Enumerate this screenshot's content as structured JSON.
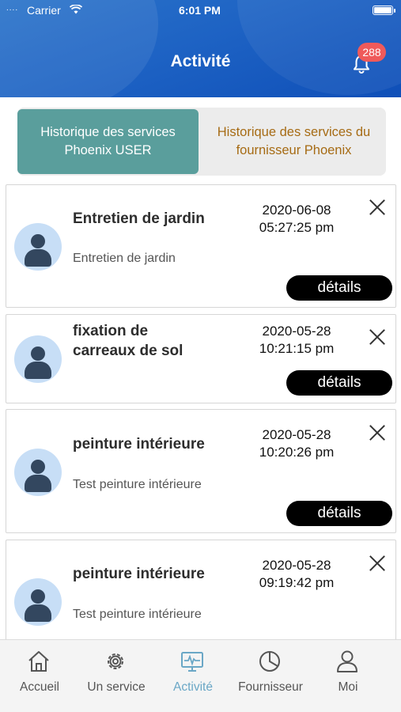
{
  "status_bar": {
    "dots": "....",
    "carrier": "Carrier",
    "time": "6:01 PM",
    "wifi_icon": "wifi-icon",
    "battery_icon": "battery-icon"
  },
  "header": {
    "title": "Activité",
    "notification_count": "288",
    "bell_icon": "bell-icon"
  },
  "tabs": [
    {
      "label_line1": "Historique des services",
      "label_line2": "Phoenix USER",
      "active": true
    },
    {
      "label_line1": "Historique des services du",
      "label_line2": "fournisseur Phoenix",
      "active": false
    }
  ],
  "activities": [
    {
      "title_line1": "Entretien de jardin",
      "title_line2": "",
      "description": "Entretien de jardin",
      "date": "2020-06-08",
      "time": "05:27:25 pm",
      "details_label": "détails"
    },
    {
      "title_line1": "fixation de",
      "title_line2": "carreaux de sol",
      "description": "",
      "date": "2020-05-28",
      "time": "10:21:15 pm",
      "details_label": "détails"
    },
    {
      "title_line1": "peinture intérieure",
      "title_line2": "",
      "description": "Test peinture intérieure",
      "date": "2020-05-28",
      "time": "10:20:26 pm",
      "details_label": "détails"
    },
    {
      "title_line1": "peinture intérieure",
      "title_line2": "",
      "description": "Test peinture intérieure",
      "date": "2020-05-28",
      "time": "09:19:42 pm",
      "details_label": ""
    }
  ],
  "bottom_nav": [
    {
      "label": "Accueil",
      "icon": "home-icon"
    },
    {
      "label": "Un service",
      "icon": "gear-icon"
    },
    {
      "label": "Activité",
      "icon": "monitor-pulse-icon",
      "active": true
    },
    {
      "label": "Fournisseur",
      "icon": "pie-chart-icon"
    },
    {
      "label": "Moi",
      "icon": "user-icon"
    }
  ],
  "colors": {
    "header": "#1e63c4",
    "active_tab": "#5a9e9c",
    "inactive_tab_text": "#a66b14",
    "badge": "#ef5a5a",
    "nav_active": "#6aa7c6"
  }
}
